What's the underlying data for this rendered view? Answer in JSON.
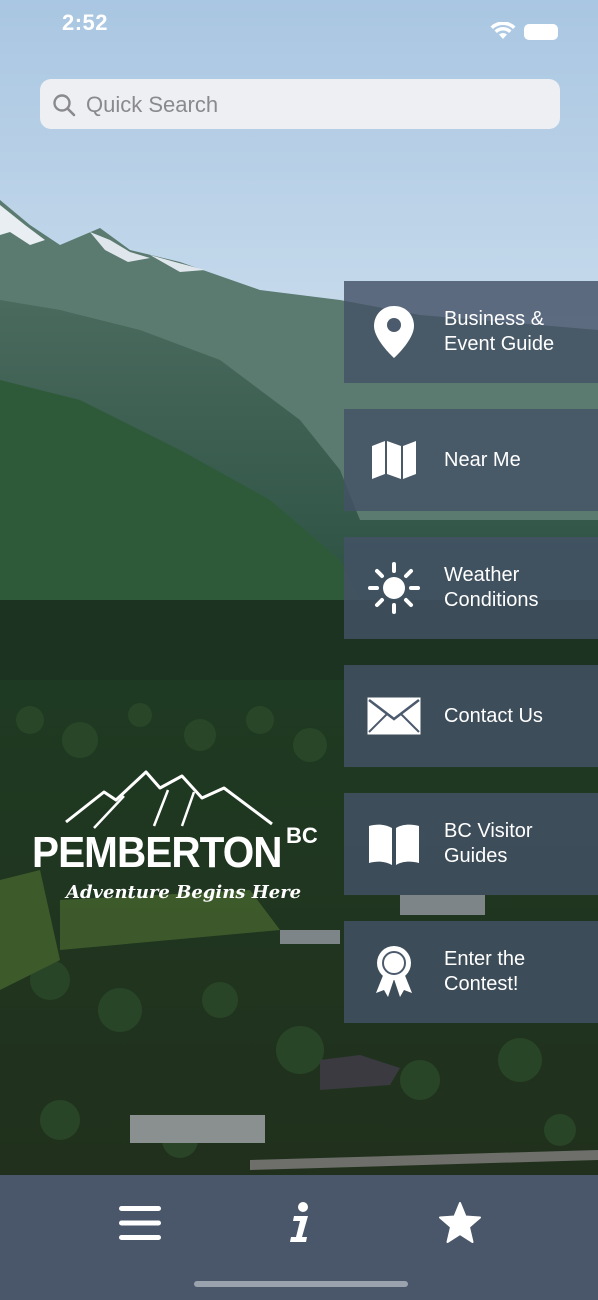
{
  "status_bar": {
    "time": "2:52"
  },
  "search": {
    "placeholder": "Quick Search"
  },
  "menu": [
    {
      "icon": "map-pin-icon",
      "label_line1": "Business &",
      "label_line2": "Event Guide"
    },
    {
      "icon": "map-icon",
      "label_line1": "Near Me",
      "label_line2": ""
    },
    {
      "icon": "sun-icon",
      "label_line1": "Weather",
      "label_line2": "Conditions"
    },
    {
      "icon": "envelope-icon",
      "label_line1": "Contact Us",
      "label_line2": ""
    },
    {
      "icon": "book-icon",
      "label_line1": "BC Visitor",
      "label_line2": "Guides"
    },
    {
      "icon": "award-ribbon-icon",
      "label_line1": "Enter the",
      "label_line2": "Contest!"
    }
  ],
  "logo": {
    "word": "PEMBERTON",
    "suffix": "BC",
    "tagline": "Adventure Begins Here"
  },
  "tabbar": {
    "tabs": [
      "menu-icon",
      "info-icon",
      "star-icon"
    ]
  },
  "colors": {
    "menu_bg": "#445266",
    "tabbar_bg": "#4a5669",
    "search_bg": "#f0f0f2"
  }
}
